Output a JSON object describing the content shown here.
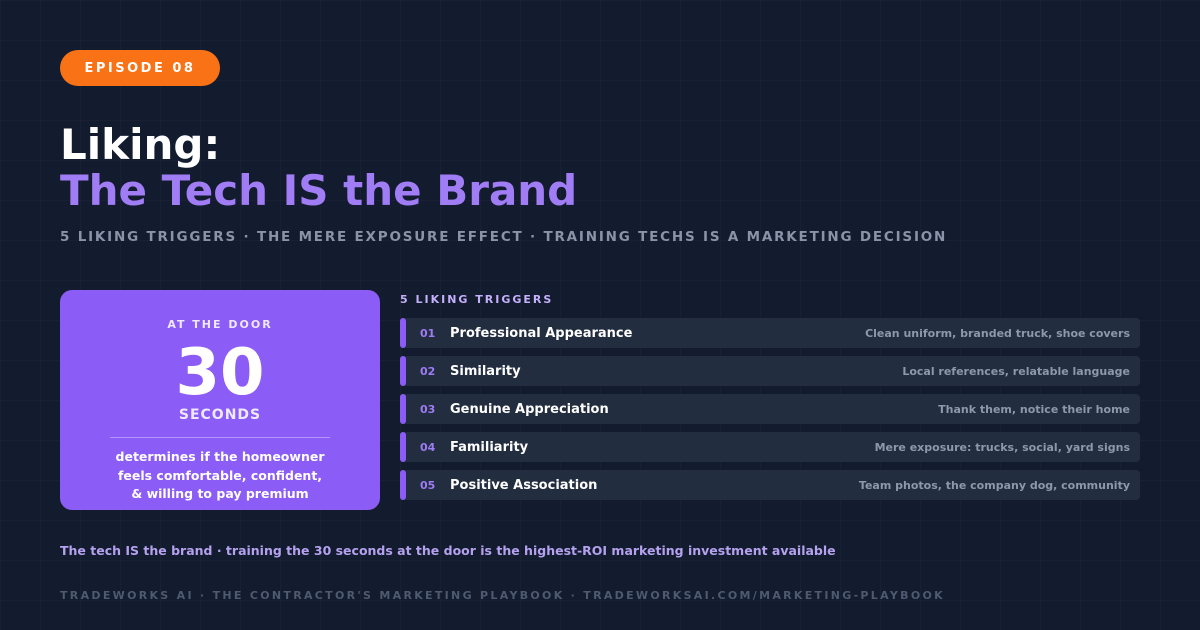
{
  "badge": "EPISODE 08",
  "title": {
    "line1": "Liking:",
    "line2": "The Tech IS the Brand"
  },
  "subtitle": "5 LIKING TRIGGERS · THE MERE EXPOSURE EFFECT · TRAINING TECHS IS A MARKETING DECISION",
  "door_card": {
    "label": "AT THE DOOR",
    "number": "30",
    "unit": "SECONDS",
    "desc_lines": [
      "determines if the homeowner",
      "feels comfortable, confident,",
      "& willing to pay premium"
    ]
  },
  "triggers": {
    "heading": "5 LIKING TRIGGERS",
    "items": [
      {
        "num": "01",
        "name": "Professional Appearance",
        "detail": "Clean uniform, branded truck, shoe covers"
      },
      {
        "num": "02",
        "name": "Similarity",
        "detail": "Local references, relatable language"
      },
      {
        "num": "03",
        "name": "Genuine Appreciation",
        "detail": "Thank them, notice their home"
      },
      {
        "num": "04",
        "name": "Familiarity",
        "detail": "Mere exposure: trucks, social, yard signs"
      },
      {
        "num": "05",
        "name": "Positive Association",
        "detail": "Team photos, the company dog, community"
      }
    ]
  },
  "tagline": "The tech IS the brand · training the 30 seconds at the door is the highest-ROI marketing investment available",
  "footer": "TRADEWORKS AI · THE CONTRACTOR'S MARKETING PLAYBOOK · TRADEWORKSAI.COM/MARKETING-PLAYBOOK",
  "colors": {
    "background": "#131b2e",
    "accent_orange": "#f97316",
    "accent_purple": "#8b5cf6",
    "title_purple": "#a07cf5"
  }
}
